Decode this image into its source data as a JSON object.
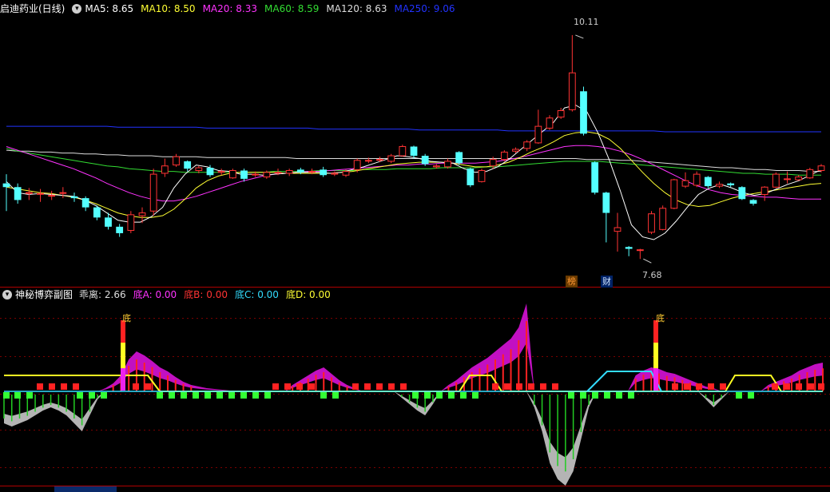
{
  "main_legend": {
    "title": "启迪药业(日线)",
    "ma": [
      {
        "label": "MA5: 8.65",
        "color": "#ffffff"
      },
      {
        "label": "MA10: 8.50",
        "color": "#ffff33"
      },
      {
        "label": "MA20: 8.33",
        "color": "#ff33ff"
      },
      {
        "label": "MA60: 8.59",
        "color": "#33dd33"
      },
      {
        "label": "MA120: 8.63",
        "color": "#dddddd"
      },
      {
        "label": "MA250: 9.06",
        "color": "#2233ff"
      }
    ]
  },
  "sub_legend": {
    "title": "神秘博弈副图",
    "items": [
      {
        "label": "乖离: 2.66",
        "color": "#dddddd"
      },
      {
        "label": "底A: 0.00",
        "color": "#ff33ff"
      },
      {
        "label": "底B: 0.00",
        "color": "#ff3333"
      },
      {
        "label": "底C: 0.00",
        "color": "#33ddff"
      },
      {
        "label": "底D: 0.00",
        "color": "#ffff33"
      }
    ]
  },
  "annotations": {
    "high": "10.11",
    "low": "7.68",
    "bang": "榜",
    "cai": "财",
    "di": "底"
  },
  "colors": {
    "up": "#ff3333",
    "down": "#54ffff",
    "grid": "#7a0000",
    "divider": "#b00000"
  },
  "chart_data": {
    "type": "candlestick",
    "price_range": [
      7.68,
      10.11
    ],
    "candles": [
      {
        "o": 8.5,
        "c": 8.46,
        "h": 8.6,
        "l": 8.2
      },
      {
        "o": 8.46,
        "c": 8.32,
        "h": 8.5,
        "l": 8.28
      },
      {
        "o": 8.4,
        "c": 8.4,
        "h": 8.45,
        "l": 8.32
      },
      {
        "o": 8.39,
        "c": 8.39,
        "h": 8.44,
        "l": 8.3
      },
      {
        "o": 8.37,
        "c": 8.37,
        "h": 8.42,
        "l": 8.32
      },
      {
        "o": 8.4,
        "c": 8.4,
        "h": 8.46,
        "l": 8.34
      },
      {
        "o": 8.36,
        "c": 8.34,
        "h": 8.4,
        "l": 8.3
      },
      {
        "o": 8.34,
        "c": 8.24,
        "h": 8.36,
        "l": 8.2
      },
      {
        "o": 8.24,
        "c": 8.13,
        "h": 8.26,
        "l": 8.1
      },
      {
        "o": 8.13,
        "c": 8.03,
        "h": 8.18,
        "l": 8.0
      },
      {
        "o": 8.03,
        "c": 7.96,
        "h": 8.06,
        "l": 7.92
      },
      {
        "o": 7.99,
        "c": 8.16,
        "h": 8.2,
        "l": 7.96
      },
      {
        "o": 8.15,
        "c": 8.18,
        "h": 8.24,
        "l": 8.07
      },
      {
        "o": 8.2,
        "c": 8.6,
        "h": 8.66,
        "l": 8.15
      },
      {
        "o": 8.61,
        "c": 8.69,
        "h": 8.77,
        "l": 8.57
      },
      {
        "o": 8.7,
        "c": 8.79,
        "h": 8.82,
        "l": 8.68
      },
      {
        "o": 8.74,
        "c": 8.66,
        "h": 8.75,
        "l": 8.63
      },
      {
        "o": 8.64,
        "c": 8.67,
        "h": 8.69,
        "l": 8.61
      },
      {
        "o": 8.67,
        "c": 8.59,
        "h": 8.7,
        "l": 8.57
      },
      {
        "o": 8.62,
        "c": 8.63,
        "h": 8.66,
        "l": 8.59
      },
      {
        "o": 8.56,
        "c": 8.64,
        "h": 8.66,
        "l": 8.55
      },
      {
        "o": 8.64,
        "c": 8.55,
        "h": 8.66,
        "l": 8.52
      },
      {
        "o": 8.6,
        "c": 8.6,
        "h": 8.63,
        "l": 8.57
      },
      {
        "o": 8.57,
        "c": 8.62,
        "h": 8.64,
        "l": 8.55
      },
      {
        "o": 8.62,
        "c": 8.62,
        "h": 8.66,
        "l": 8.59
      },
      {
        "o": 8.61,
        "c": 8.64,
        "h": 8.66,
        "l": 8.58
      },
      {
        "o": 8.65,
        "c": 8.62,
        "h": 8.67,
        "l": 8.6
      },
      {
        "o": 8.63,
        "c": 8.63,
        "h": 8.66,
        "l": 8.6
      },
      {
        "o": 8.65,
        "c": 8.59,
        "h": 8.68,
        "l": 8.57
      },
      {
        "o": 8.6,
        "c": 8.61,
        "h": 8.63,
        "l": 8.58
      },
      {
        "o": 8.59,
        "c": 8.63,
        "h": 8.65,
        "l": 8.57
      },
      {
        "o": 8.65,
        "c": 8.75,
        "h": 8.77,
        "l": 8.62
      },
      {
        "o": 8.75,
        "c": 8.75,
        "h": 8.78,
        "l": 8.72
      },
      {
        "o": 8.76,
        "c": 8.76,
        "h": 8.79,
        "l": 8.73
      },
      {
        "o": 8.74,
        "c": 8.8,
        "h": 8.82,
        "l": 8.72
      },
      {
        "o": 8.8,
        "c": 8.9,
        "h": 8.92,
        "l": 8.79
      },
      {
        "o": 8.9,
        "c": 8.8,
        "h": 8.91,
        "l": 8.77
      },
      {
        "o": 8.8,
        "c": 8.71,
        "h": 8.82,
        "l": 8.69
      },
      {
        "o": 8.68,
        "c": 8.69,
        "h": 8.71,
        "l": 8.66
      },
      {
        "o": 8.68,
        "c": 8.74,
        "h": 8.77,
        "l": 8.66
      },
      {
        "o": 8.84,
        "c": 8.72,
        "h": 8.85,
        "l": 8.7
      },
      {
        "o": 8.66,
        "c": 8.48,
        "h": 8.67,
        "l": 8.46
      },
      {
        "o": 8.52,
        "c": 8.64,
        "h": 8.66,
        "l": 8.51
      },
      {
        "o": 8.69,
        "c": 8.76,
        "h": 8.79,
        "l": 8.66
      },
      {
        "o": 8.76,
        "c": 8.84,
        "h": 8.86,
        "l": 8.74
      },
      {
        "o": 8.85,
        "c": 8.87,
        "h": 8.89,
        "l": 8.83
      },
      {
        "o": 8.88,
        "c": 8.95,
        "h": 8.97,
        "l": 8.85
      },
      {
        "o": 8.94,
        "c": 9.12,
        "h": 9.3,
        "l": 8.93
      },
      {
        "o": 9.1,
        "c": 9.21,
        "h": 9.24,
        "l": 9.08
      },
      {
        "o": 9.22,
        "c": 9.29,
        "h": 9.32,
        "l": 9.2
      },
      {
        "o": 9.3,
        "c": 9.7,
        "h": 10.11,
        "l": 9.28
      },
      {
        "o": 9.5,
        "c": 9.04,
        "h": 9.55,
        "l": 9.02
      },
      {
        "o": 8.73,
        "c": 8.4,
        "h": 8.74,
        "l": 8.38
      },
      {
        "o": 8.4,
        "c": 8.18,
        "h": 8.41,
        "l": 7.86
      },
      {
        "o": 7.98,
        "c": 8.02,
        "h": 8.18,
        "l": 7.76
      },
      {
        "o": 7.81,
        "c": 7.79,
        "h": 7.82,
        "l": 7.71
      },
      {
        "o": 7.78,
        "c": 7.78,
        "h": 7.79,
        "l": 7.68
      },
      {
        "o": 7.97,
        "c": 8.17,
        "h": 8.2,
        "l": 7.95
      },
      {
        "o": 8.0,
        "c": 8.23,
        "h": 8.26,
        "l": 7.99
      },
      {
        "o": 8.23,
        "c": 8.54,
        "h": 8.55,
        "l": 8.22
      },
      {
        "o": 8.47,
        "c": 8.53,
        "h": 8.62,
        "l": 8.45
      },
      {
        "o": 8.48,
        "c": 8.6,
        "h": 8.63,
        "l": 8.46
      },
      {
        "o": 8.57,
        "c": 8.47,
        "h": 8.58,
        "l": 8.45
      },
      {
        "o": 8.47,
        "c": 8.49,
        "h": 8.52,
        "l": 8.45
      },
      {
        "o": 8.5,
        "c": 8.48,
        "h": 8.51,
        "l": 8.46
      },
      {
        "o": 8.46,
        "c": 8.33,
        "h": 8.47,
        "l": 8.32
      },
      {
        "o": 8.32,
        "c": 8.28,
        "h": 8.33,
        "l": 8.26
      },
      {
        "o": 8.38,
        "c": 8.46,
        "h": 8.47,
        "l": 8.31
      },
      {
        "o": 8.46,
        "c": 8.6,
        "h": 8.62,
        "l": 8.45
      },
      {
        "o": 8.55,
        "c": 8.55,
        "h": 8.63,
        "l": 8.5
      },
      {
        "o": 8.54,
        "c": 8.57,
        "h": 8.59,
        "l": 8.53
      },
      {
        "o": 8.56,
        "c": 8.65,
        "h": 8.67,
        "l": 8.55
      },
      {
        "o": 8.64,
        "c": 8.69,
        "h": 8.71,
        "l": 8.62
      }
    ],
    "ma5": [
      8.52,
      8.4,
      8.38,
      8.39,
      8.38,
      8.37,
      8.36,
      8.32,
      8.26,
      8.18,
      8.1,
      8.08,
      8.08,
      8.14,
      8.24,
      8.45,
      8.6,
      8.7,
      8.68,
      8.64,
      8.63,
      8.6,
      8.6,
      8.59,
      8.6,
      8.61,
      8.62,
      8.62,
      8.62,
      8.61,
      8.62,
      8.65,
      8.68,
      8.72,
      8.76,
      8.8,
      8.79,
      8.77,
      8.74,
      8.73,
      8.72,
      8.66,
      8.62,
      8.63,
      8.68,
      8.76,
      8.86,
      8.96,
      9.06,
      9.16,
      9.32,
      9.35,
      9.28,
      9.05,
      8.76,
      8.42,
      8.05,
      7.92,
      7.89,
      7.96,
      8.09,
      8.24,
      8.38,
      8.45,
      8.49,
      8.45,
      8.4,
      8.37,
      8.39,
      8.44,
      8.49,
      8.53,
      8.59,
      8.65
    ],
    "ma10": [
      8.46,
      8.44,
      8.42,
      8.4,
      8.39,
      8.37,
      8.35,
      8.32,
      8.28,
      8.23,
      8.18,
      8.15,
      8.13,
      8.13,
      8.15,
      8.22,
      8.33,
      8.45,
      8.53,
      8.58,
      8.61,
      8.62,
      8.62,
      8.62,
      8.62,
      8.61,
      8.61,
      8.61,
      8.61,
      8.61,
      8.62,
      8.63,
      8.65,
      8.67,
      8.69,
      8.71,
      8.72,
      8.73,
      8.73,
      8.73,
      8.72,
      8.7,
      8.68,
      8.68,
      8.7,
      8.73,
      8.78,
      8.84,
      8.89,
      8.95,
      9.02,
      9.05,
      9.06,
      9.04,
      8.98,
      8.88,
      8.75,
      8.62,
      8.5,
      8.4,
      8.32,
      8.27,
      8.25,
      8.26,
      8.3,
      8.34,
      8.37,
      8.39,
      8.41,
      8.43,
      8.45,
      8.47,
      8.49,
      8.5
    ],
    "ma20": [
      8.9,
      8.86,
      8.82,
      8.78,
      8.74,
      8.7,
      8.66,
      8.61,
      8.56,
      8.5,
      8.45,
      8.4,
      8.36,
      8.33,
      8.31,
      8.31,
      8.33,
      8.36,
      8.4,
      8.44,
      8.48,
      8.52,
      8.55,
      8.58,
      8.6,
      8.61,
      8.62,
      8.63,
      8.63,
      8.64,
      8.65,
      8.66,
      8.67,
      8.68,
      8.69,
      8.7,
      8.7,
      8.71,
      8.71,
      8.72,
      8.72,
      8.72,
      8.72,
      8.73,
      8.74,
      8.76,
      8.78,
      8.81,
      8.84,
      8.87,
      8.9,
      8.91,
      8.91,
      8.9,
      8.88,
      8.85,
      8.81,
      8.76,
      8.7,
      8.64,
      8.58,
      8.52,
      8.47,
      8.43,
      8.4,
      8.38,
      8.37,
      8.36,
      8.35,
      8.35,
      8.34,
      8.33,
      8.33,
      8.33
    ],
    "ma60": [
      8.88,
      8.85,
      8.83,
      8.81,
      8.79,
      8.77,
      8.75,
      8.73,
      8.71,
      8.69,
      8.68,
      8.66,
      8.65,
      8.64,
      8.63,
      8.63,
      8.62,
      8.62,
      8.62,
      8.62,
      8.62,
      8.62,
      8.62,
      8.62,
      8.63,
      8.63,
      8.63,
      8.63,
      8.64,
      8.64,
      8.64,
      8.64,
      8.65,
      8.65,
      8.65,
      8.66,
      8.66,
      8.66,
      8.66,
      8.67,
      8.67,
      8.67,
      8.67,
      8.68,
      8.68,
      8.69,
      8.7,
      8.71,
      8.72,
      8.73,
      8.74,
      8.74,
      8.74,
      8.74,
      8.73,
      8.72,
      8.71,
      8.7,
      8.69,
      8.68,
      8.67,
      8.66,
      8.65,
      8.64,
      8.63,
      8.62,
      8.61,
      8.61,
      8.6,
      8.6,
      8.6,
      8.59,
      8.59,
      8.59
    ],
    "ma120": [
      8.86,
      8.85,
      8.85,
      8.84,
      8.84,
      8.83,
      8.83,
      8.82,
      8.82,
      8.81,
      8.81,
      8.8,
      8.8,
      8.8,
      8.79,
      8.79,
      8.79,
      8.79,
      8.78,
      8.78,
      8.78,
      8.78,
      8.78,
      8.78,
      8.78,
      8.78,
      8.77,
      8.77,
      8.77,
      8.77,
      8.77,
      8.77,
      8.77,
      8.77,
      8.77,
      8.77,
      8.77,
      8.77,
      8.77,
      8.77,
      8.77,
      8.77,
      8.77,
      8.77,
      8.77,
      8.77,
      8.77,
      8.77,
      8.77,
      8.77,
      8.77,
      8.77,
      8.76,
      8.76,
      8.76,
      8.75,
      8.75,
      8.74,
      8.73,
      8.72,
      8.71,
      8.7,
      8.69,
      8.68,
      8.67,
      8.67,
      8.66,
      8.65,
      8.65,
      8.64,
      8.64,
      8.64,
      8.63,
      8.63
    ],
    "ma250": [
      9.12,
      9.12,
      9.12,
      9.12,
      9.12,
      9.12,
      9.12,
      9.12,
      9.12,
      9.12,
      9.11,
      9.11,
      9.11,
      9.11,
      9.11,
      9.11,
      9.11,
      9.11,
      9.1,
      9.1,
      9.1,
      9.1,
      9.1,
      9.1,
      9.1,
      9.1,
      9.1,
      9.1,
      9.09,
      9.09,
      9.09,
      9.09,
      9.09,
      9.09,
      9.09,
      9.09,
      9.09,
      9.08,
      9.08,
      9.08,
      9.08,
      9.08,
      9.08,
      9.08,
      9.08,
      9.07,
      9.07,
      9.07,
      9.07,
      9.07,
      9.07,
      9.07,
      9.07,
      9.07,
      9.07,
      9.07,
      9.07,
      9.07,
      9.07,
      9.06,
      9.06,
      9.06,
      9.06,
      9.06,
      9.06,
      9.06,
      9.06,
      9.06,
      9.06,
      9.06,
      9.06,
      9.06,
      9.06,
      9.06
    ],
    "osc_upper": [
      0,
      0,
      0,
      0,
      0,
      0,
      0,
      0,
      0,
      0,
      0,
      0,
      0,
      4,
      10,
      20,
      40,
      50,
      45,
      38,
      30,
      25,
      18,
      12,
      8,
      6,
      4,
      3,
      2,
      1,
      0,
      0,
      0,
      0,
      0,
      0,
      0,
      8,
      14,
      20,
      26,
      30,
      22,
      14,
      8,
      4,
      0,
      0,
      0,
      0,
      0,
      0,
      0,
      0,
      0,
      0,
      0,
      8,
      14,
      22,
      30,
      36,
      42,
      50,
      58,
      66,
      80,
      110,
      0,
      0,
      0,
      0,
      0,
      0,
      0,
      0,
      0,
      0,
      0,
      0,
      0,
      20,
      26,
      30,
      28,
      24,
      22,
      18,
      14,
      10,
      6,
      4,
      0,
      0,
      0,
      0,
      0,
      0,
      8,
      12,
      16,
      20,
      26,
      30,
      34,
      36
    ],
    "osc_lower": [
      -40,
      -44,
      -40,
      -36,
      -30,
      -24,
      -20,
      -24,
      -30,
      -40,
      -50,
      -30,
      -10,
      0,
      0,
      0,
      0,
      0,
      0,
      0,
      0,
      0,
      0,
      0,
      0,
      0,
      0,
      0,
      0,
      0,
      0,
      0,
      0,
      0,
      0,
      0,
      0,
      0,
      0,
      0,
      0,
      0,
      0,
      0,
      0,
      0,
      0,
      0,
      0,
      0,
      0,
      -8,
      -16,
      -24,
      -30,
      -16,
      0,
      0,
      0,
      0,
      0,
      0,
      0,
      0,
      0,
      0,
      0,
      0,
      -20,
      -50,
      -90,
      -110,
      -118,
      -100,
      -60,
      -20,
      0,
      0,
      0,
      0,
      0,
      0,
      0,
      0,
      0,
      0,
      0,
      0,
      0,
      0,
      -10,
      -20,
      -10,
      0,
      0,
      0,
      0,
      0,
      0,
      0,
      0,
      0,
      0
    ]
  }
}
